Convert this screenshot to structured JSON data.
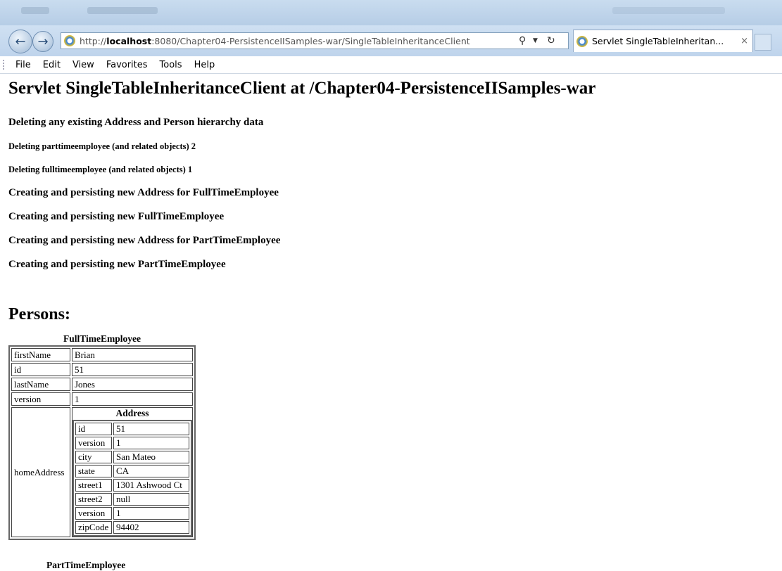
{
  "browser": {
    "url_prefix": "http://",
    "url_host": "localhost",
    "url_rest": ":8080/Chapter04-PersistenceIISamples-war/SingleTableInheritanceClient",
    "tab_title": "Servlet SingleTableInheritan...",
    "tab_close": "×",
    "menu": [
      "File",
      "Edit",
      "View",
      "Favorites",
      "Tools",
      "Help"
    ]
  },
  "page": {
    "title": "Servlet SingleTableInheritanceClient at /Chapter04-PersistenceIISamples-war",
    "messages": [
      "Deleting any existing Address and Person hierarchy data",
      "Deleting parttimeemployee (and related objects) 2",
      "Deleting fulltimeemployee (and related objects) 1",
      "Creating and persisting new Address for FullTimeEmployee",
      "Creating and persisting new FullTimeEmployee",
      "Creating and persisting new Address for PartTimeEmployee",
      "Creating and persisting new PartTimeEmployee"
    ],
    "persons_heading": "Persons:",
    "full_time_employee": {
      "caption": "FullTimeEmployee",
      "rows": [
        {
          "key": "firstName",
          "value": "Brian"
        },
        {
          "key": "id",
          "value": "51"
        },
        {
          "key": "lastName",
          "value": "Jones"
        },
        {
          "key": "version",
          "value": "1"
        }
      ],
      "home_address_key": "homeAddress",
      "address": {
        "caption": "Address",
        "rows": [
          {
            "key": "id",
            "value": "51"
          },
          {
            "key": "version",
            "value": "1"
          },
          {
            "key": "city",
            "value": "San Mateo"
          },
          {
            "key": "state",
            "value": "CA"
          },
          {
            "key": "street1",
            "value": "1301 Ashwood Ct"
          },
          {
            "key": "street2",
            "value": "null"
          },
          {
            "key": "version",
            "value": "1"
          },
          {
            "key": "zipCode",
            "value": "94402"
          }
        ]
      }
    },
    "next_caption": "PartTimeEmployee"
  }
}
